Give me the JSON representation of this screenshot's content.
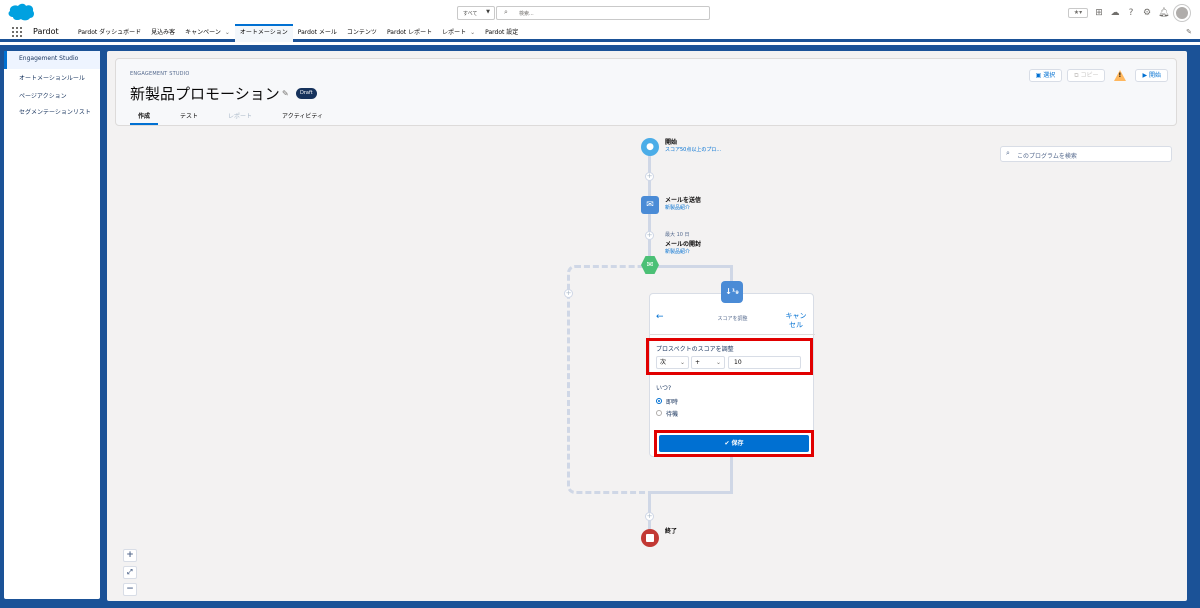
{
  "header": {
    "scope_label": "すべて",
    "search_placeholder": "検索...",
    "fav_label": "★▾"
  },
  "nav": {
    "app_name": "Pardot",
    "items": [
      {
        "label": "Pardot ダッシュボード",
        "chevron": false
      },
      {
        "label": "見込み客",
        "chevron": false
      },
      {
        "label": "キャンペーン",
        "chevron": true
      },
      {
        "label": "オートメーション",
        "chevron": false,
        "active": true
      },
      {
        "label": "Pardot メール",
        "chevron": false
      },
      {
        "label": "コンテンツ",
        "chevron": false
      },
      {
        "label": "Pardot レポート",
        "chevron": false
      },
      {
        "label": "レポート",
        "chevron": true
      },
      {
        "label": "Pardot 設定",
        "chevron": false
      }
    ]
  },
  "sidebar": {
    "items": [
      {
        "label": "Engagement Studio",
        "active": true
      },
      {
        "label": "オートメーションルール"
      },
      {
        "label": "ページアクション"
      },
      {
        "label": "セグメンテーションリスト"
      }
    ]
  },
  "page": {
    "eyebrow": "ENGAGEMENT STUDIO",
    "title": "新製品プロモーション",
    "badge": "Draft",
    "tabs": [
      {
        "label": "作成",
        "state": "active"
      },
      {
        "label": "テスト",
        "state": "normal"
      },
      {
        "label": "レポート",
        "state": "disabled"
      },
      {
        "label": "アクティビティ",
        "state": "normal"
      }
    ],
    "buttons": {
      "select": "選択",
      "copy": "コピー",
      "start": "開始"
    },
    "search_placeholder": "このプログラムを検索"
  },
  "flow": {
    "start": {
      "label": "開始",
      "sub": "スコア50点以上のプロ..."
    },
    "send_email": {
      "label": "メールを送信",
      "sub": "新製品紹介"
    },
    "open_email": {
      "wait": "最大 10 日",
      "label": "メールの開封",
      "sub": "新製品紹介"
    },
    "end": {
      "label": "終了"
    }
  },
  "card": {
    "icon_text": "↓¹₉",
    "title": "スコアを調整",
    "cancel": "キャンセル",
    "field_label": "プロスペクトのスコアを調整",
    "mode_value": "次",
    "operator_value": "+",
    "amount_value": "10",
    "when_label": "いつ?",
    "options": [
      {
        "label": "即時",
        "selected": true
      },
      {
        "label": "待機",
        "selected": false
      }
    ],
    "save_label": "✔ 保存"
  },
  "zoom": {
    "in": "+",
    "fit": "⤢",
    "out": "−"
  },
  "colors": {
    "brand_blue": "#0070d2",
    "shell_blue": "#1b5297",
    "highlight_red": "#e10000",
    "trigger_green": "#4bc076",
    "end_red": "#c23934"
  }
}
